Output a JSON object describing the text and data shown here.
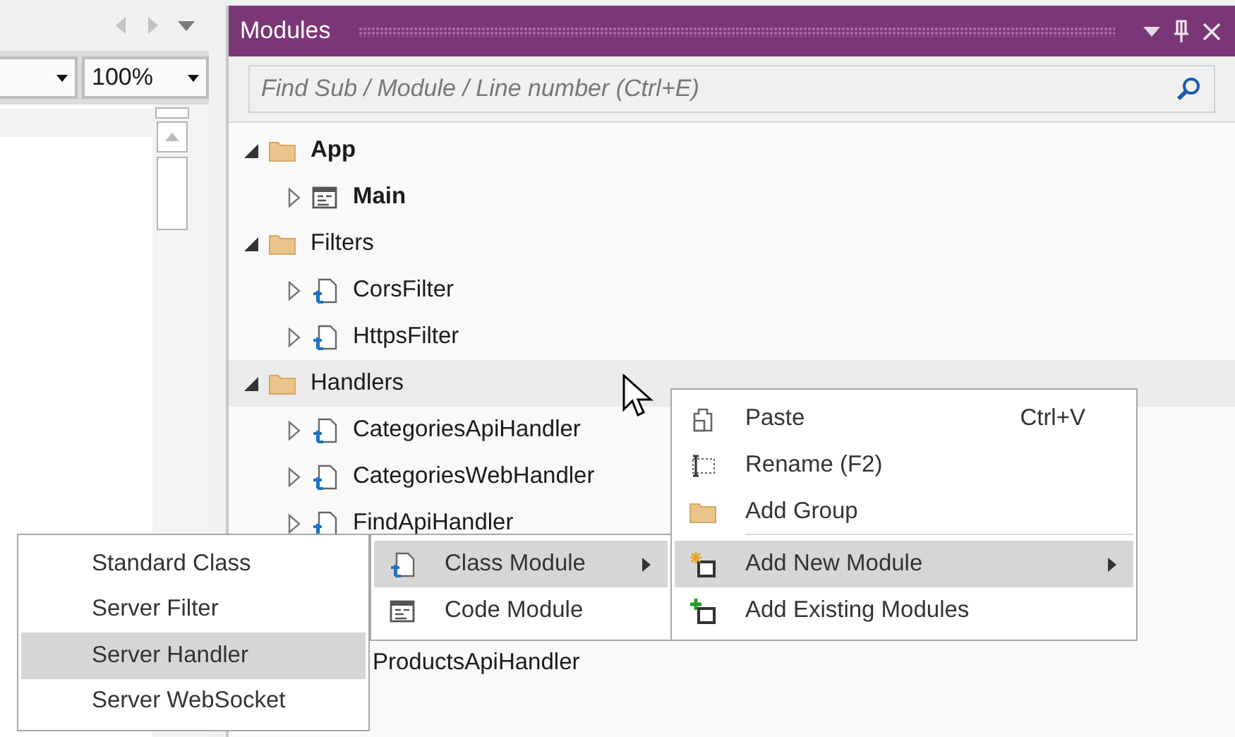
{
  "editor_pane": {
    "zoom_combo": {
      "value": "100%"
    }
  },
  "modules_panel": {
    "title": "Modules",
    "search": {
      "placeholder": "Find Sub / Module / Line number (Ctrl+E)"
    },
    "tree": [
      {
        "label": "App",
        "kind": "group",
        "bold": true,
        "expanded": true,
        "selected": false,
        "children": [
          {
            "label": "Main",
            "kind": "code",
            "bold": true,
            "expanded": false,
            "selected": false
          }
        ]
      },
      {
        "label": "Filters",
        "kind": "group",
        "bold": false,
        "expanded": true,
        "selected": false,
        "children": [
          {
            "label": "CorsFilter",
            "kind": "class",
            "bold": false,
            "expanded": false,
            "selected": false
          },
          {
            "label": "HttpsFilter",
            "kind": "class",
            "bold": false,
            "expanded": false,
            "selected": false
          }
        ]
      },
      {
        "label": "Handlers",
        "kind": "group",
        "bold": false,
        "expanded": true,
        "selected": true,
        "children": [
          {
            "label": "CategoriesApiHandler",
            "kind": "class",
            "bold": false,
            "expanded": false,
            "selected": false
          },
          {
            "label": "CategoriesWebHandler",
            "kind": "class",
            "bold": false,
            "expanded": false,
            "selected": false
          },
          {
            "label": "FindApiHandler",
            "kind": "class",
            "bold": false,
            "expanded": false,
            "selected": false
          },
          {
            "label": "ProductsApiHandler",
            "bold": false,
            "selected": false
          }
        ]
      }
    ]
  },
  "context_menu": {
    "items": [
      {
        "label": "Paste",
        "shortcut": "Ctrl+V",
        "kind": "paste",
        "selected": false,
        "has_submenu": false,
        "separator_after": false
      },
      {
        "label": "Rename (F2)",
        "kind": "rename",
        "selected": false,
        "has_submenu": false,
        "separator_after": false
      },
      {
        "label": "Add Group",
        "kind": "group",
        "selected": false,
        "has_submenu": false,
        "separator_after": true
      },
      {
        "label": "Add New Module",
        "kind": "addnew",
        "selected": true,
        "has_submenu": true,
        "separator_after": false
      },
      {
        "label": "Add Existing Modules",
        "kind": "addexisting",
        "selected": false,
        "has_submenu": false,
        "separator_after": false
      }
    ]
  },
  "add_new_submenu": {
    "items": [
      {
        "label": "Class Module",
        "kind": "class",
        "selected": true,
        "has_submenu": true
      },
      {
        "label": "Code Module",
        "kind": "code",
        "selected": false,
        "has_submenu": false
      }
    ]
  },
  "class_submenu": {
    "items": [
      {
        "label": "Standard Class",
        "selected": false
      },
      {
        "label": "Server Filter",
        "selected": false
      },
      {
        "label": "Server Handler",
        "selected": true
      },
      {
        "label": "Server WebSocket",
        "selected": false
      }
    ]
  }
}
